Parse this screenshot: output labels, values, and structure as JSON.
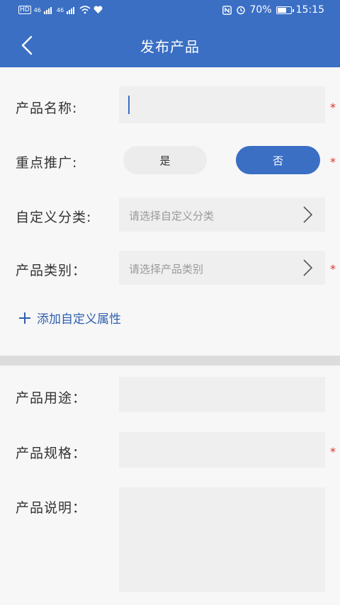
{
  "status_bar": {
    "left_signals": [
      "HD",
      "46",
      "46"
    ],
    "battery_percent": "70%",
    "battery_level": 0.7,
    "time": "15:15"
  },
  "header": {
    "title": "发布产品",
    "bg_color": "#3a6fc4"
  },
  "form": {
    "product_name": {
      "label": "产品名称:",
      "value": "",
      "required": "*"
    },
    "featured": {
      "label": "重点推广:",
      "yes_label": "是",
      "no_label": "否",
      "selected": "否",
      "required": "*"
    },
    "custom_category": {
      "label": "自定义分类:",
      "placeholder": "请选择自定义分类"
    },
    "product_category": {
      "label": "产品类别：",
      "placeholder": "请选择产品类别",
      "required": "*"
    },
    "add_attribute": {
      "icon": "plus-icon",
      "label": "添加自定义属性"
    },
    "usage": {
      "label": "产品用途：",
      "value": ""
    },
    "spec": {
      "label": "产品规格：",
      "value": "",
      "required": "*"
    },
    "description": {
      "label": "产品说明：",
      "value": ""
    }
  },
  "colors": {
    "primary": "#3a6fc4",
    "required": "#d9342b",
    "field_bg": "#efefef"
  }
}
